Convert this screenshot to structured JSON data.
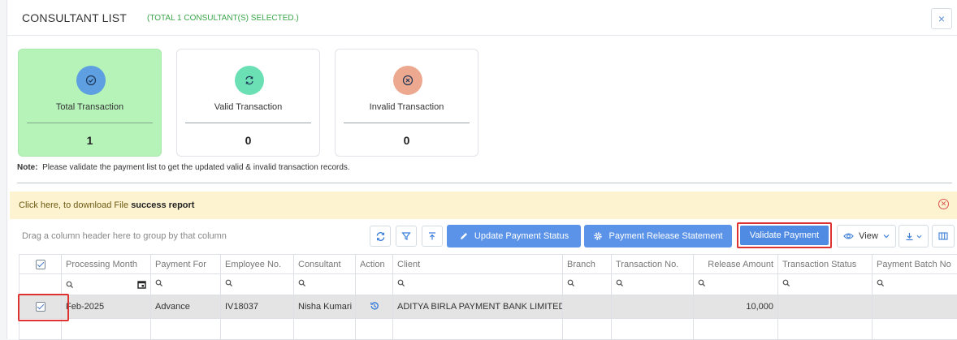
{
  "header": {
    "title": "CONSULTANT LIST",
    "subtitle": "(TOTAL 1 CONSULTANT(S) SELECTED.)",
    "close_label": "×"
  },
  "cards": [
    {
      "label": "Total Transaction",
      "count": "1",
      "color": "#5d9fe0",
      "icon": "check-circle-icon"
    },
    {
      "label": "Valid Transaction",
      "count": "0",
      "color": "#6be0b5",
      "icon": "refresh-icon"
    },
    {
      "label": "Invalid Transaction",
      "count": "0",
      "color": "#eda98f",
      "icon": "x-circle-icon"
    }
  ],
  "note": {
    "label": "Note:",
    "text": "Please validate the payment list to get the updated valid & invalid transaction records."
  },
  "banner": {
    "prefix": "Click here, to download File",
    "link": "success report"
  },
  "toolbar": {
    "group_hint": "Drag a column header here to group by that column",
    "update_status": "Update Payment Status",
    "release_statement": "Payment Release Statement",
    "validate": "Validate Payment",
    "view": "View"
  },
  "grid": {
    "columns": [
      "Processing Month",
      "Payment For",
      "Employee No.",
      "Consultant",
      "Action",
      "Client",
      "Branch",
      "Transaction No.",
      "Release Amount",
      "Transaction Status",
      "Payment Batch No"
    ],
    "rows": [
      {
        "processing_month": "Feb-2025",
        "payment_for": "Advance",
        "employee_no": "IV18037",
        "consultant": "Nisha Kumari",
        "client": "ADITYA BIRLA PAYMENT BANK LIMITED",
        "branch": "",
        "transaction_no": "",
        "release_amount": "10,000",
        "transaction_status": "",
        "batch_no": ""
      }
    ]
  },
  "colors": {
    "accent": "#5b93e8",
    "success": "#3aa54a",
    "danger": "#d33"
  }
}
